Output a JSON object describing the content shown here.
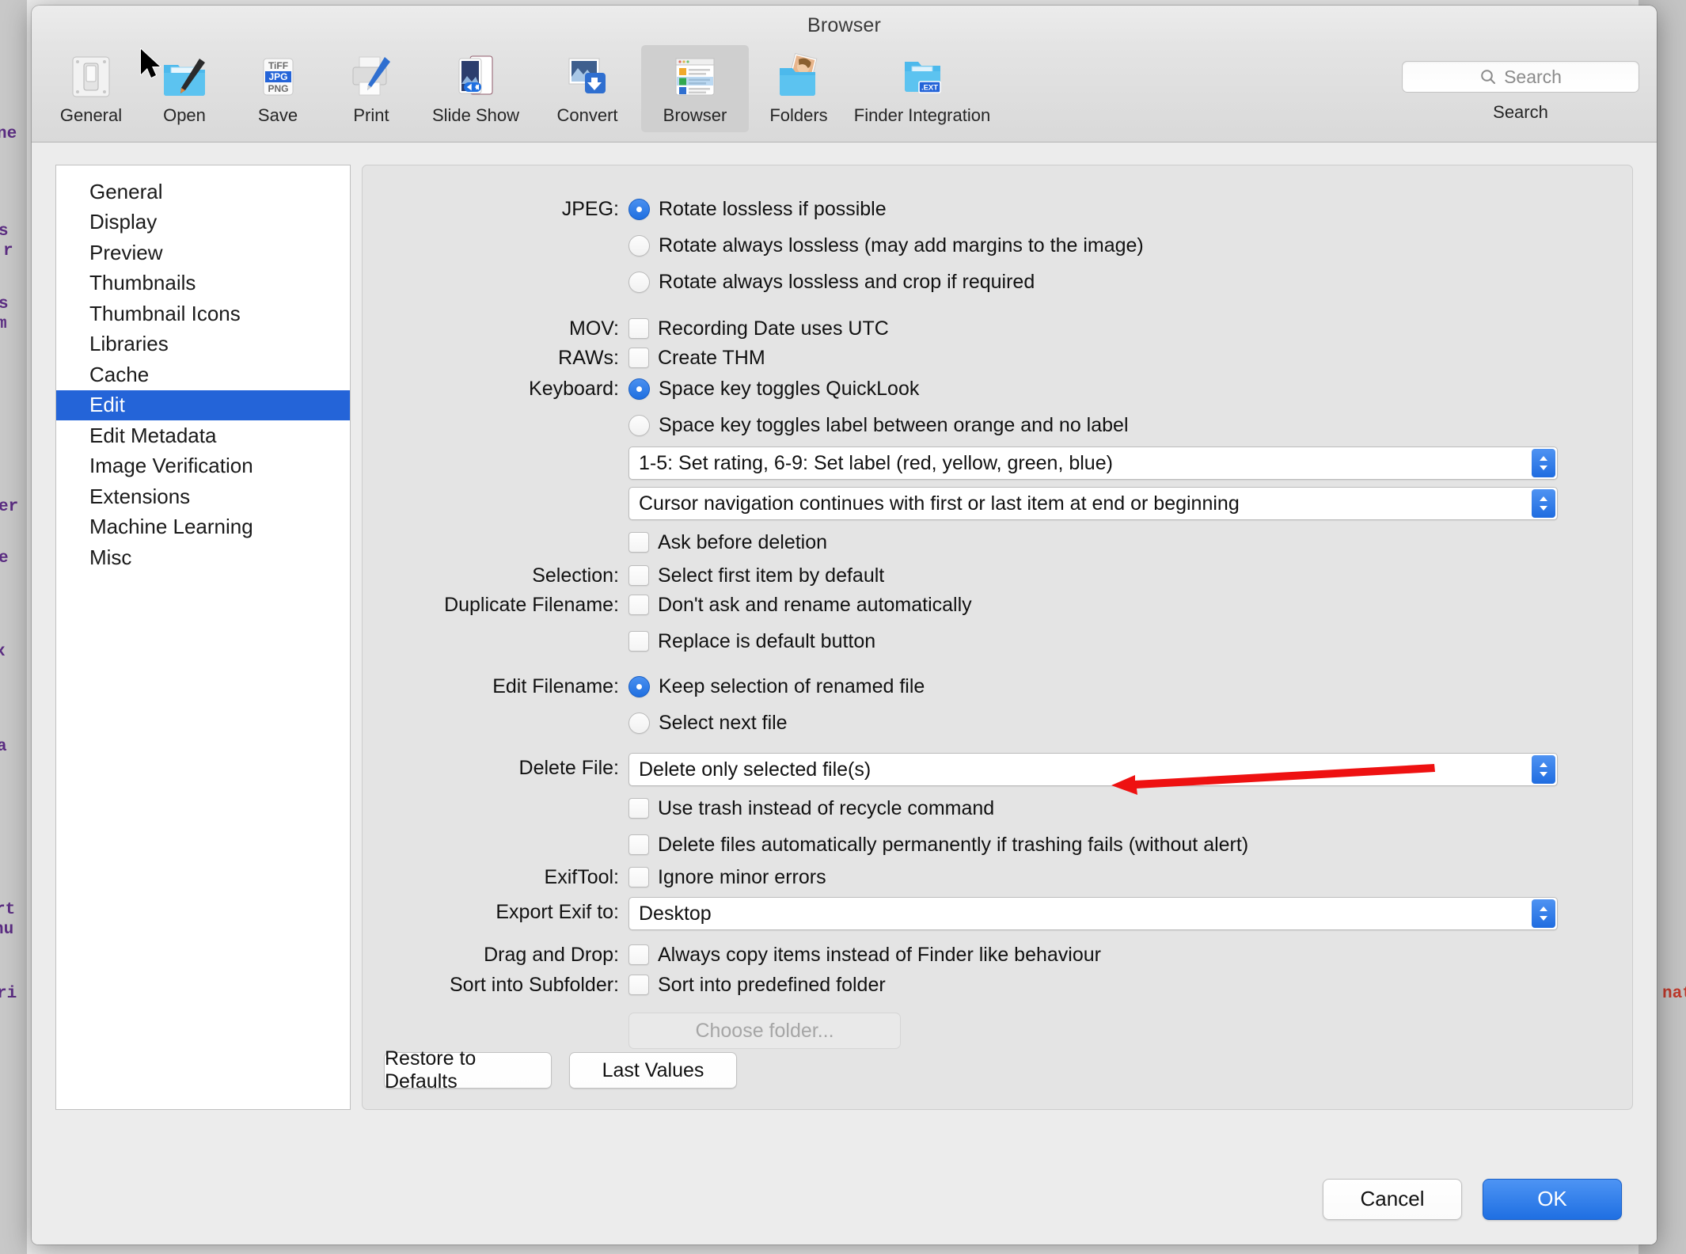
{
  "window": {
    "title": "Browser"
  },
  "toolbar": {
    "items": [
      {
        "label": "General",
        "icon": "switch-icon"
      },
      {
        "label": "Open",
        "icon": "folder-brush-icon"
      },
      {
        "label": "Save",
        "icon": "format-list-icon"
      },
      {
        "label": "Print",
        "icon": "printer-icon"
      },
      {
        "label": "Slide Show",
        "icon": "slideshow-icon"
      },
      {
        "label": "Convert",
        "icon": "convert-arrow-icon"
      },
      {
        "label": "Browser",
        "icon": "browser-window-icon"
      },
      {
        "label": "Folders",
        "icon": "folder-photo-icon"
      },
      {
        "label": "Finder Integration",
        "icon": "folder-ext-icon"
      }
    ],
    "selected": "Browser",
    "save_icon_text": [
      "TiFF",
      "JPG",
      "PNG"
    ],
    "finder_ext_badge": ".EXT"
  },
  "search": {
    "placeholder": "Search",
    "value": "",
    "caption": "Search",
    "icon": "search-icon"
  },
  "sidebar": {
    "items": [
      "General",
      "Display",
      "Preview",
      "Thumbnails",
      "Thumbnail Icons",
      "Libraries",
      "Cache",
      "Edit",
      "Edit Metadata",
      "Image Verification",
      "Extensions",
      "Machine Learning",
      "Misc"
    ],
    "selected": "Edit"
  },
  "form": {
    "jpeg": {
      "label": "JPEG:",
      "options": [
        {
          "text": "Rotate lossless if possible",
          "selected": true
        },
        {
          "text": "Rotate always lossless (may add margins to the image)",
          "selected": false
        },
        {
          "text": "Rotate always lossless and crop if required",
          "selected": false
        }
      ]
    },
    "mov": {
      "label": "MOV:",
      "checkbox": {
        "text": "Recording Date uses UTC",
        "checked": false
      }
    },
    "raws": {
      "label": "RAWs:",
      "checkbox": {
        "text": "Create THM",
        "checked": false
      }
    },
    "keyboard": {
      "label": "Keyboard:",
      "radios": [
        {
          "text": "Space key toggles QuickLook",
          "selected": true
        },
        {
          "text": "Space key toggles label between orange and no label",
          "selected": false
        }
      ],
      "popup1": "1-5: Set rating, 6-9: Set label (red, yellow, green, blue)",
      "popup2": "Cursor navigation continues with first or last item at end or beginning",
      "checkbox": {
        "text": "Ask before deletion",
        "checked": false
      }
    },
    "selection": {
      "label": "Selection:",
      "checkbox": {
        "text": "Select first item by default",
        "checked": false
      }
    },
    "duplicate_filename": {
      "label": "Duplicate Filename:",
      "checkboxes": [
        {
          "text": "Don't ask and rename automatically",
          "checked": false
        },
        {
          "text": "Replace is default button",
          "checked": false
        }
      ]
    },
    "edit_filename": {
      "label": "Edit Filename:",
      "options": [
        {
          "text": "Keep selection of renamed file",
          "selected": true
        },
        {
          "text": "Select next file",
          "selected": false
        }
      ]
    },
    "delete_file": {
      "label": "Delete File:",
      "popup": "Delete only selected file(s)",
      "checkboxes": [
        {
          "text": "Use trash instead of recycle command",
          "checked": false
        },
        {
          "text": "Delete files automatically permanently if trashing fails (without alert)",
          "checked": false
        }
      ]
    },
    "exiftool": {
      "label": "ExifTool:",
      "checkbox": {
        "text": "Ignore minor errors",
        "checked": false
      }
    },
    "export_exif": {
      "label": "Export Exif to:",
      "popup": "Desktop"
    },
    "drag_and_drop": {
      "label": "Drag  and Drop:",
      "checkbox": {
        "text": "Always copy items instead of Finder like behaviour",
        "checked": false
      }
    },
    "sort_into_subfolder": {
      "label": "Sort into Subfolder:",
      "checkbox": {
        "text": "Sort into predefined folder",
        "checked": false
      },
      "button": "Choose folder..."
    },
    "footer_buttons": {
      "restore": "Restore to Defaults",
      "last_values": "Last Values"
    }
  },
  "dialog_footer": {
    "cancel": "Cancel",
    "ok": "OK"
  },
  "annotation": {
    "arrow_color": "#ee1111",
    "points_at": "Use trash instead of recycle command"
  },
  "background_text": {
    "left_fragments": [
      "ne",
      "s",
      "r",
      "s",
      "m",
      "er",
      "e",
      "x",
      "a",
      "rt",
      "nu",
      "ri"
    ],
    "right_fragments": [
      "nat"
    ]
  },
  "colors": {
    "accent": "#2464d8",
    "selection_blue": "#2464d8",
    "ok_button": "#1f6fe2",
    "arrow_red": "#ee1111"
  }
}
